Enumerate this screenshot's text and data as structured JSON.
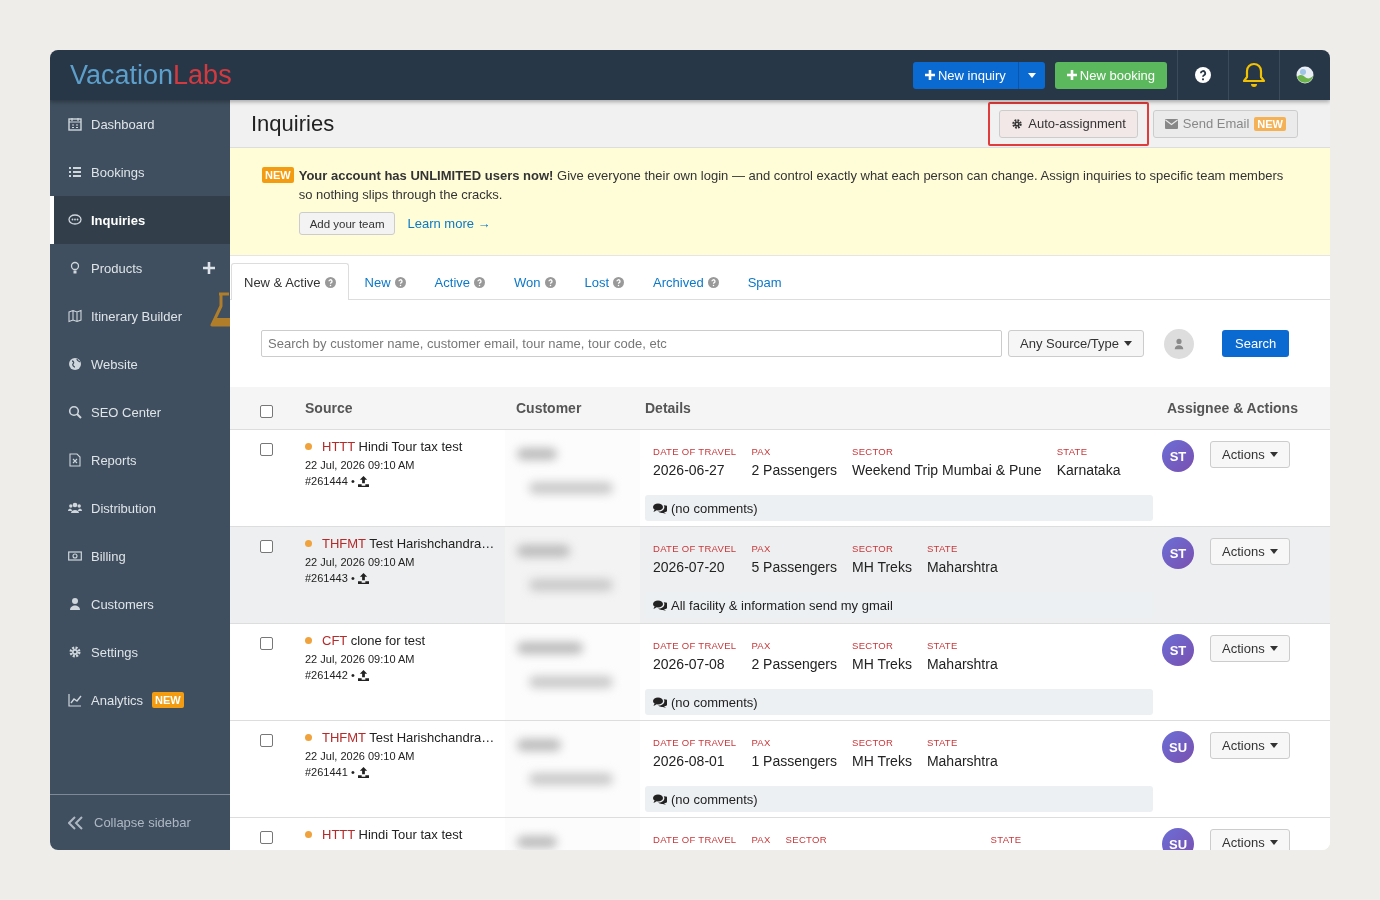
{
  "header": {
    "logo": {
      "first": "Vacation",
      "second": "Labs"
    },
    "new_inquiry": "New inquiry",
    "new_booking": "New booking"
  },
  "sidebar": {
    "items": [
      {
        "label": "Dashboard",
        "selected": false
      },
      {
        "label": "Bookings",
        "selected": false
      },
      {
        "label": "Inquiries",
        "selected": true
      },
      {
        "label": "Products",
        "selected": false,
        "add_button": true
      },
      {
        "label": "Itinerary Builder",
        "selected": false,
        "beta": true
      },
      {
        "label": "Website",
        "selected": false
      },
      {
        "label": "SEO Center",
        "selected": false
      },
      {
        "label": "Reports",
        "selected": false
      },
      {
        "label": "Distribution",
        "selected": false
      },
      {
        "label": "Billing",
        "selected": false
      },
      {
        "label": "Customers",
        "selected": false
      },
      {
        "label": "Settings",
        "selected": false
      },
      {
        "label": "Analytics",
        "selected": false,
        "badge": "NEW"
      }
    ],
    "collapse": "Collapse sidebar"
  },
  "page": {
    "title": "Inquiries",
    "auto_assignment": {
      "label": "Auto-assignment",
      "highlighted": true
    },
    "send_email": {
      "label": "Send Email",
      "badge": "NEW",
      "disabled": true
    }
  },
  "banner": {
    "badge": "NEW",
    "text": "**Your account has UNLIMITED users now!** Give everyone their own login — and control exactly what each person can change. Assign inquiries to specific team members so nothing slips through the cracks.",
    "button": "Add your team",
    "link": "Learn more →"
  },
  "tabs": [
    {
      "label": "New & Active",
      "selected": true,
      "help": true
    },
    {
      "label": "New",
      "selected": false,
      "help": true
    },
    {
      "label": "Active",
      "selected": false,
      "help": true
    },
    {
      "label": "Won",
      "selected": false,
      "help": true
    },
    {
      "label": "Lost",
      "selected": false,
      "help": true
    },
    {
      "label": "Archived",
      "selected": false,
      "help": true
    },
    {
      "label": "Spam",
      "selected": false,
      "help": false
    }
  ],
  "search": {
    "placeholder": "Search by customer name, customer email, tour name, tour code, etc",
    "source_type": "Any Source/Type",
    "button": "Search"
  },
  "table": {
    "select_all": {
      "checked": false
    },
    "columns": [
      "Source",
      "Customer",
      "Details",
      "Assignee & Actions"
    ],
    "rows": [
      {
        "code": "HTTT",
        "title": "Hindi Tour tax test",
        "date": "22 Jul, 2026 09:10 AM",
        "id": "#261444 •",
        "checked": false,
        "hovered": false,
        "fields": [
          {
            "label": "DATE OF TRAVEL",
            "value": "2026-06-27"
          },
          {
            "label": "PAX",
            "value": "2 Passengers"
          },
          {
            "label": "SECTOR",
            "value": "Weekend Trip Mumbai & Pune"
          },
          {
            "label": "STATE",
            "value": "Karnataka"
          }
        ],
        "comment": "(no comments)",
        "assignee": "ST",
        "action": "Actions"
      },
      {
        "code": "THFMT",
        "title": "Test Harishchandra…",
        "date": "22 Jul, 2026 09:10 AM",
        "id": "#261443 •",
        "checked": false,
        "hovered": true,
        "fields": [
          {
            "label": "DATE OF TRAVEL",
            "value": "2026-07-20"
          },
          {
            "label": "PAX",
            "value": "5 Passengers"
          },
          {
            "label": "SECTOR",
            "value": "MH Treks"
          },
          {
            "label": "STATE",
            "value": "Maharshtra"
          }
        ],
        "comment": "All facility & information send my gmail",
        "assignee": "ST",
        "action": "Actions"
      },
      {
        "code": "CFT",
        "title": "clone for test",
        "date": "22 Jul, 2026 09:10 AM",
        "id": "#261442 •",
        "checked": false,
        "hovered": false,
        "fields": [
          {
            "label": "DATE OF TRAVEL",
            "value": "2026-07-08"
          },
          {
            "label": "PAX",
            "value": "2 Passengers"
          },
          {
            "label": "SECTOR",
            "value": "MH Treks"
          },
          {
            "label": "STATE",
            "value": "Maharshtra"
          }
        ],
        "comment": "(no comments)",
        "assignee": "ST",
        "action": "Actions"
      },
      {
        "code": "THFMT",
        "title": "Test Harishchandra…",
        "date": "22 Jul, 2026 09:10 AM",
        "id": "#261441 •",
        "checked": false,
        "hovered": false,
        "fields": [
          {
            "label": "DATE OF TRAVEL",
            "value": "2026-08-01"
          },
          {
            "label": "PAX",
            "value": "1 Passengers"
          },
          {
            "label": "SECTOR",
            "value": "MH Treks"
          },
          {
            "label": "STATE",
            "value": "Maharshtra"
          }
        ],
        "comment": "(no comments)",
        "assignee": "SU",
        "action": "Actions"
      },
      {
        "code": "HTTT",
        "title": "Hindi Tour tax test",
        "checked": false,
        "hovered": false,
        "fields": [
          {
            "label": "DATE OF TRAVEL"
          },
          {
            "label": "PAX"
          },
          {
            "label": "SECTOR",
            "wide": true
          },
          {
            "label": "STATE"
          }
        ],
        "assignee": "SU",
        "action": "Actions"
      }
    ]
  }
}
